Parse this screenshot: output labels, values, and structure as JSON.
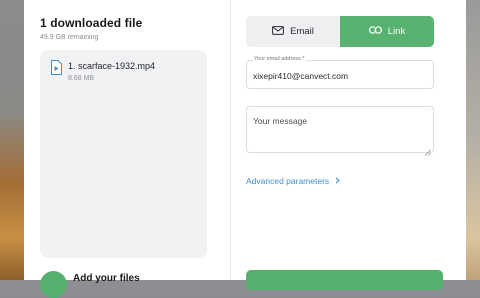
{
  "transfer": {
    "title": "1 downloaded file",
    "remaining": "49.9 GB remaining",
    "files": [
      {
        "name": "1. scarface-1932.mp4",
        "size": "8.68 MB",
        "icon": "video-file-icon"
      }
    ],
    "add_label": "Add your files"
  },
  "tabs": [
    {
      "label": "Email",
      "icon": "envelope-icon",
      "active": false
    },
    {
      "label": "Link",
      "icon": "link-icon",
      "active": true
    }
  ],
  "form": {
    "email_label": "Your email address *",
    "email_value": "xixepir410@canvect.com",
    "message_placeholder": "Your message",
    "advanced_label": "Advanced parameters"
  },
  "colors": {
    "accent": "#57b36f",
    "link": "#3f8fd0"
  }
}
